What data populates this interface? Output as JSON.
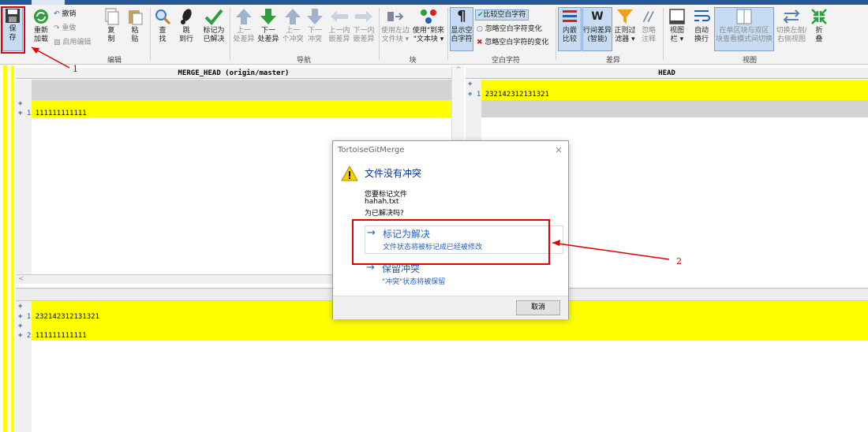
{
  "ribbon": {
    "save": "保\n存",
    "reload": "重新\n加载",
    "undo": "撤销",
    "redo": "重做",
    "enable_edit": "启用编辑",
    "copy": "复\n制",
    "paste": "粘\n贴",
    "find": "查\n找",
    "goto": "跳\n到行",
    "mark_resolved": "标记为\n已解决",
    "prev_diff": "上一\n处差异",
    "next_diff": "下一\n处差异",
    "prev_conflict": "上一\n个冲突",
    "next_conflict": "下一\n冲突",
    "prev_inline": "上一内\n嵌差异",
    "next_inline": "下一内\n嵌差异",
    "use_left_block": "使用左边\n文件块 ▾",
    "use_text_block": "使用\"到来\n\"文本块 ▾",
    "show_whitespace": "显示空\n白字符",
    "compare_ws": "比较空白字符",
    "ignore_ws_change": "忽略空白字符变化",
    "ignore_all_ws": "忽略空白字符的变化",
    "inline_compare": "内嵌\n比较",
    "line_diff": "行间差异\n(智能)",
    "regex_filter": "正则过\n滤器 ▾",
    "ignore_comments": "忽略\n注释",
    "view_bar": "视图\n栏 ▾",
    "wrap": "自动\n换行",
    "single_view": "在单区块与双区\n块查看模式间切换",
    "switch_lr": "切换左侧/\n右侧视图",
    "fold": "折\n叠",
    "groups": {
      "edit": "编辑",
      "nav": "导航",
      "block": "块",
      "whitespace": "空白字符",
      "diff": "差异",
      "view": "视图"
    }
  },
  "panes": {
    "left_title": "MERGE_HEAD (origin/master)",
    "right_title": "HEAD",
    "left_line": "111111111111",
    "right_line": "232142312131321",
    "bottom_line1": "232142312131321",
    "bottom_line2": "111111111111",
    "plus": "+",
    "n1": "1",
    "n2": "2",
    "lt": "<",
    "caret": "^"
  },
  "dialog": {
    "title": "TortoiseGitMerge",
    "close": "×",
    "heading": "文件没有冲突",
    "line1": "您要标记文件",
    "line2": "hahah.txt",
    "line3": "为已解决吗?",
    "opt1_title": "标记为解决",
    "opt1_desc": "文件状态将被标记成已经被修改",
    "opt2_title": "保留冲突",
    "opt2_desc": "\"冲突\"状态将被保留",
    "arrow": "→",
    "cancel": "取消"
  },
  "annotations": {
    "one": "1",
    "two": "2"
  },
  "colors": {
    "highlight": "#ffff00",
    "annotation": "#e00000",
    "accent": "#1f5fbf"
  }
}
